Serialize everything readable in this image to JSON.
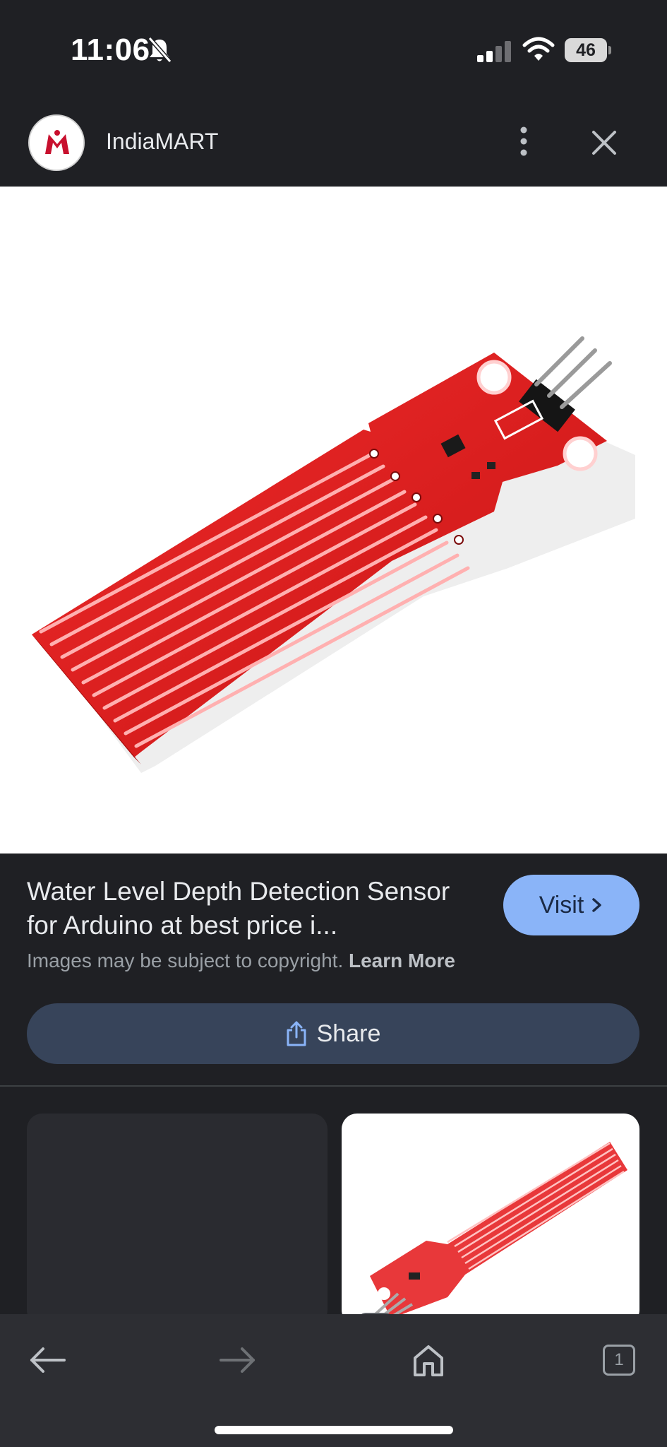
{
  "status_bar": {
    "time": "11:06",
    "battery": "46"
  },
  "header": {
    "site_name": "IndiaMART"
  },
  "result": {
    "title": "Water Level Depth Detection Sensor for Arduino at best price i...",
    "visit_label": "Visit",
    "copyright_text": "Images may be subject to copyright.",
    "learn_more": "Learn More",
    "share_label": "Share"
  },
  "bottom_nav": {
    "tab_count": "1"
  },
  "colors": {
    "background": "#1f2024",
    "accent": "#8ab4f8",
    "share": "#37445a",
    "sensor_red": "#e01c1c"
  },
  "icons": [
    "bell-off-icon",
    "signal-icon",
    "wifi-icon",
    "more-vertical-icon",
    "close-icon",
    "share-icon",
    "back-arrow-icon",
    "forward-arrow-icon",
    "home-icon",
    "tabs-icon"
  ]
}
